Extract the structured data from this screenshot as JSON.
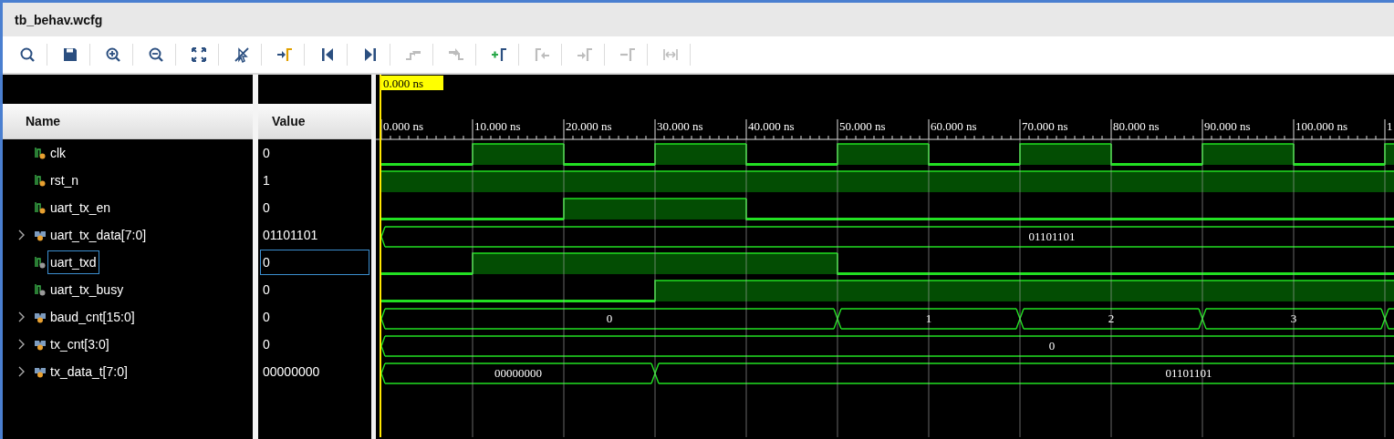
{
  "window": {
    "title": "tb_behav.wcfg"
  },
  "toolbar": [
    {
      "kind": "search",
      "disabled": false
    },
    {
      "kind": "save",
      "disabled": false
    },
    {
      "kind": "zoomin",
      "disabled": false
    },
    {
      "kind": "zoomout",
      "disabled": false
    },
    {
      "kind": "fit",
      "disabled": false
    },
    {
      "kind": "snap",
      "disabled": false
    },
    {
      "kind": "cursor",
      "disabled": false
    },
    {
      "kind": "first",
      "disabled": false
    },
    {
      "kind": "last",
      "disabled": false
    },
    {
      "kind": "prevedge",
      "disabled": true
    },
    {
      "kind": "nextedge",
      "disabled": true
    },
    {
      "kind": "addmarker",
      "disabled": false
    },
    {
      "kind": "prevmarker",
      "disabled": true
    },
    {
      "kind": "nextmarker",
      "disabled": true
    },
    {
      "kind": "delmarker",
      "disabled": true
    },
    {
      "kind": "distance",
      "disabled": true
    }
  ],
  "columns": {
    "name": "Name",
    "value": "Value"
  },
  "cursor": {
    "time": "0.000 ns"
  },
  "time_axis": [
    "0.000 ns",
    "10.000 ns",
    "20.000 ns",
    "30.000 ns",
    "40.000 ns",
    "50.000 ns",
    "60.000 ns",
    "70.000 ns",
    "80.000 ns",
    "90.000 ns",
    "100.000 ns",
    "1"
  ],
  "signals": [
    {
      "kind": "bit",
      "name": "clk",
      "value": "0",
      "color": "#e8a030",
      "selected": false,
      "high": [
        false,
        true,
        false,
        true,
        false,
        true,
        false,
        true,
        false,
        true,
        false,
        true
      ]
    },
    {
      "kind": "bit",
      "name": "rst_n",
      "value": "1",
      "color": "#e8a030",
      "selected": false,
      "high": [
        true,
        true,
        true,
        true,
        true,
        true,
        true,
        true,
        true,
        true,
        true,
        true
      ]
    },
    {
      "kind": "bit",
      "name": "uart_tx_en",
      "value": "0",
      "color": "#e8a030",
      "selected": false,
      "high": [
        false,
        false,
        true,
        true,
        false,
        false,
        false,
        false,
        false,
        false,
        false,
        false
      ]
    },
    {
      "kind": "bus",
      "name": "uart_tx_data[7:0]",
      "value": "01101101",
      "color": "#e8a030",
      "selected": false,
      "expanded": false,
      "labels": [
        "01101101"
      ],
      "starts": [
        true,
        false,
        false,
        false,
        false,
        false,
        false,
        false,
        false,
        false,
        false,
        false
      ]
    },
    {
      "kind": "bit",
      "name": "uart_txd",
      "value": "0",
      "color": "#9a9a9a",
      "selected": true,
      "high": [
        false,
        true,
        true,
        true,
        true,
        false,
        false,
        false,
        false,
        false,
        false,
        false
      ]
    },
    {
      "kind": "bit",
      "name": "uart_tx_busy",
      "value": "0",
      "color": "#9a9a9a",
      "selected": false,
      "high": [
        false,
        false,
        false,
        true,
        true,
        true,
        true,
        true,
        true,
        true,
        true,
        true
      ]
    },
    {
      "kind": "bus",
      "name": "baud_cnt[15:0]",
      "value": "0",
      "color": "#e8a030",
      "selected": false,
      "expanded": false,
      "labels": [
        "0",
        "1",
        "2",
        "3"
      ],
      "starts": [
        true,
        false,
        false,
        false,
        false,
        true,
        false,
        true,
        false,
        true,
        false,
        true
      ]
    },
    {
      "kind": "bus",
      "name": "tx_cnt[3:0]",
      "value": "0",
      "color": "#e8a030",
      "selected": false,
      "expanded": false,
      "labels": [
        "0"
      ],
      "starts": [
        true,
        false,
        false,
        false,
        false,
        false,
        false,
        false,
        false,
        false,
        false,
        false
      ]
    },
    {
      "kind": "bus",
      "name": "tx_data_t[7:0]",
      "value": "00000000",
      "color": "#e8a030",
      "selected": false,
      "expanded": false,
      "labels": [
        "00000000",
        "01101101"
      ],
      "starts": [
        true,
        false,
        false,
        true,
        false,
        false,
        false,
        false,
        false,
        false,
        false,
        false
      ]
    }
  ]
}
